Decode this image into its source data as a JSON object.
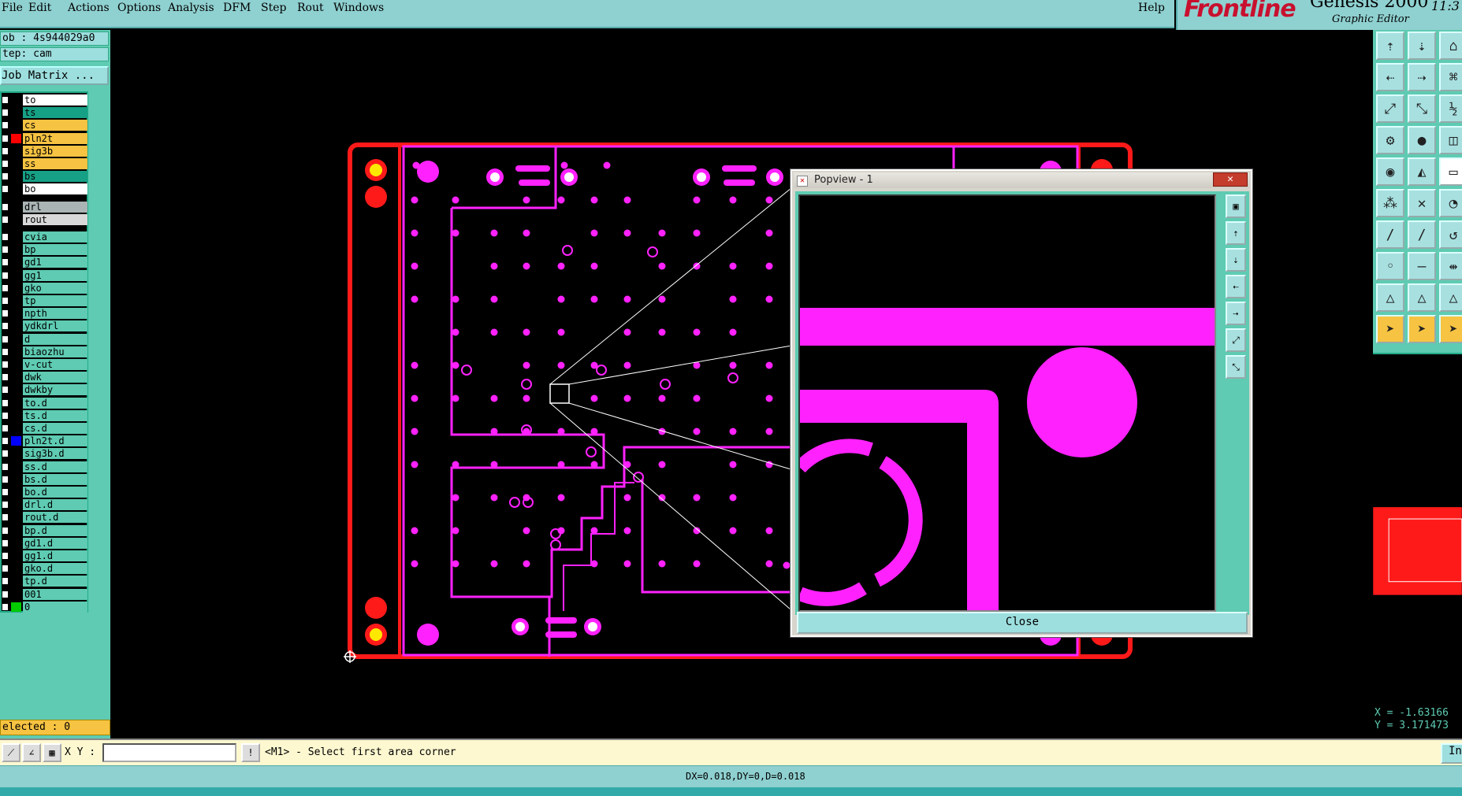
{
  "menubar": {
    "items": [
      "File",
      "Edit",
      "Actions",
      "Options",
      "Analysis",
      "DFM",
      "Step",
      "Rout",
      "Windows"
    ],
    "help": "Help"
  },
  "brand": {
    "logo": "Frontline",
    "product": "Genesis 2000",
    "subtitle": "Graphic Editor",
    "clock": "11:3"
  },
  "job": {
    "job_line": "ob : 4s944029a0",
    "step_line": "tep: cam",
    "job_matrix": "Job Matrix ..."
  },
  "layers": [
    {
      "name": "to",
      "bg": "#ffffff",
      "color": "#000000"
    },
    {
      "name": "ts",
      "bg": "#16a085",
      "color": "#000000"
    },
    {
      "name": "cs",
      "bg": "#f6c342",
      "color": "#000000"
    },
    {
      "name": "pln2t",
      "bg": "#f6c342",
      "color": "#ff0000"
    },
    {
      "name": "sig3b",
      "bg": "#f6c342",
      "color": "#000000"
    },
    {
      "name": "ss",
      "bg": "#f6c342",
      "color": "#000000"
    },
    {
      "name": "bs",
      "bg": "#16a085",
      "color": "#000000"
    },
    {
      "name": "bo",
      "bg": "#ffffff",
      "color": "#000000"
    },
    {
      "name": "drl",
      "bg": "#aab4b4",
      "color": "#000000"
    },
    {
      "name": "rout",
      "bg": "#d8d8d8",
      "color": "#000000"
    },
    {
      "name": "cvia",
      "bg": "#5ecbb2",
      "color": "#000000"
    },
    {
      "name": "bp",
      "bg": "#5ecbb2",
      "color": "#000000"
    },
    {
      "name": "gd1",
      "bg": "#5ecbb2",
      "color": "#000000"
    },
    {
      "name": "gg1",
      "bg": "#5ecbb2",
      "color": "#000000"
    },
    {
      "name": "gko",
      "bg": "#5ecbb2",
      "color": "#000000"
    },
    {
      "name": "tp",
      "bg": "#5ecbb2",
      "color": "#000000"
    },
    {
      "name": "npth",
      "bg": "#5ecbb2",
      "color": "#000000"
    },
    {
      "name": "ydkdrl",
      "bg": "#5ecbb2",
      "color": "#000000"
    },
    {
      "name": "d",
      "bg": "#5ecbb2",
      "color": "#000000"
    },
    {
      "name": "biaozhu",
      "bg": "#5ecbb2",
      "color": "#000000"
    },
    {
      "name": "v-cut",
      "bg": "#5ecbb2",
      "color": "#000000"
    },
    {
      "name": "dwk",
      "bg": "#5ecbb2",
      "color": "#000000"
    },
    {
      "name": "dwkby",
      "bg": "#5ecbb2",
      "color": "#000000"
    },
    {
      "name": "to.d",
      "bg": "#5ecbb2",
      "color": "#000000"
    },
    {
      "name": "ts.d",
      "bg": "#5ecbb2",
      "color": "#000000"
    },
    {
      "name": "cs.d",
      "bg": "#5ecbb2",
      "color": "#000000"
    },
    {
      "name": "pln2t.d",
      "bg": "#5ecbb2",
      "color": "#0000ff"
    },
    {
      "name": "sig3b.d",
      "bg": "#5ecbb2",
      "color": "#000000"
    },
    {
      "name": "ss.d",
      "bg": "#5ecbb2",
      "color": "#000000"
    },
    {
      "name": "bs.d",
      "bg": "#5ecbb2",
      "color": "#000000"
    },
    {
      "name": "bo.d",
      "bg": "#5ecbb2",
      "color": "#000000"
    },
    {
      "name": "drl.d",
      "bg": "#5ecbb2",
      "color": "#000000"
    },
    {
      "name": "rout.d",
      "bg": "#5ecbb2",
      "color": "#000000"
    },
    {
      "name": "bp.d",
      "bg": "#5ecbb2",
      "color": "#000000"
    },
    {
      "name": "gd1.d",
      "bg": "#5ecbb2",
      "color": "#000000"
    },
    {
      "name": "gg1.d",
      "bg": "#5ecbb2",
      "color": "#000000"
    },
    {
      "name": "gko.d",
      "bg": "#5ecbb2",
      "color": "#000000"
    },
    {
      "name": "tp.d",
      "bg": "#5ecbb2",
      "color": "#000000"
    },
    {
      "name": "001",
      "bg": "#5ecbb2",
      "color": "#000000"
    },
    {
      "name": "0",
      "bg": "#5ecbb2",
      "color": "#00cc00"
    }
  ],
  "selected": "elected : 0",
  "popview": {
    "title": "Popview - 1",
    "close_label": "Close",
    "close_x": "✕"
  },
  "coords": {
    "x": "X = -1.63166",
    "y": "Y = 3.171473"
  },
  "command": {
    "xy_label": "X Y :",
    "xy_value": "",
    "prompt": "<M1> - Select first area corner",
    "in_label": "In"
  },
  "status": {
    "text": "DX=0.018,DY=0,D=0.018"
  },
  "colors": {
    "board_outline": "#ff1a1a",
    "copper": "#ff22ff",
    "pad_yellow": "#ffe800",
    "panel": "#5ecbb2"
  }
}
